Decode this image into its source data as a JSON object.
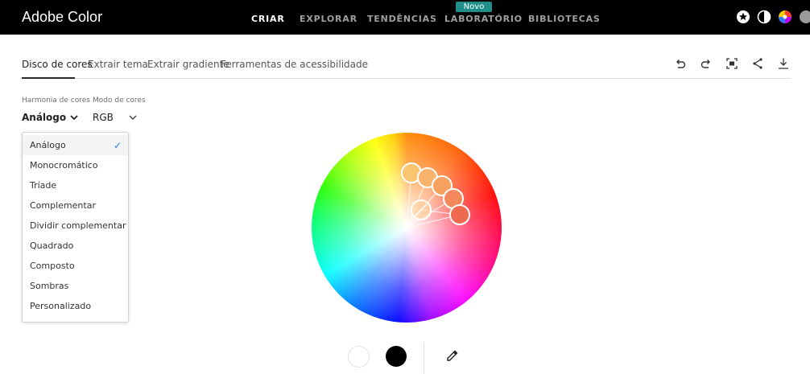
{
  "app": {
    "title": "Adobe Color"
  },
  "nav": {
    "items": [
      "CRIAR",
      "EXPLORAR",
      "TENDÊNCIAS",
      "LABORATÓRIO",
      "BIBLIOTECAS"
    ],
    "badge": "Novo"
  },
  "top_icons": [
    "star-circle-icon",
    "theme-half-icon",
    "color-wheel-avatar-icon",
    "help-icon"
  ],
  "tabs": [
    "Disco de cores",
    "Extrair tema",
    "Extrair gradiente",
    "Ferramentas de acessibilidade"
  ],
  "toolbar_icons": [
    "undo-icon",
    "redo-icon",
    "expand-icon",
    "share-icon",
    "download-icon"
  ],
  "controls": {
    "harmony_label": "Harmonia de cores",
    "harmony_value": "Análogo",
    "mode_label": "Modo de cores",
    "mode_value": "RGB"
  },
  "harmony_options": [
    "Análogo",
    "Monocromático",
    "Tríade",
    "Complementar",
    "Dividir complementar",
    "Quadrado",
    "Composto",
    "Sombras",
    "Personalizado"
  ],
  "selected_option": "Análogo",
  "colors": {
    "accent_check": "#2680eb",
    "badge": "#1f8f8a",
    "topbar": "#000000"
  },
  "bottom": {
    "swatches": [
      "white-swatch",
      "black-swatch"
    ],
    "tool": "eyedropper-icon"
  }
}
